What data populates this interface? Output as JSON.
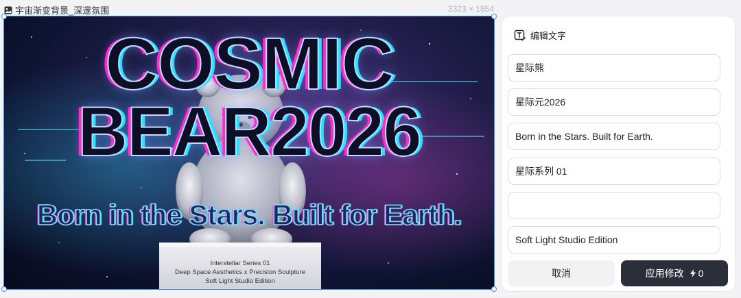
{
  "header": {
    "filename": "宇宙渐变背景_深邃氛围",
    "dimensions": "3323 × 1854"
  },
  "canvas": {
    "title_line1": "COSMIC",
    "title_line2": "BEAR2026",
    "tagline": "Born in the Stars. Built for Earth.",
    "pedestal_lines": [
      "Interstellar Series 01",
      "Deep Space Aesthetics x Precision Sculpture",
      "Soft Light Studio Edition"
    ]
  },
  "panel": {
    "title": "编辑文字",
    "fields": [
      "星际熊",
      "星际元2026",
      "Born in the Stars. Built for Earth.",
      "星际系列 01",
      "",
      "Soft Light Studio Edition"
    ],
    "cancel_label": "取消",
    "apply_label": "应用修改",
    "apply_cost": "0"
  },
  "icons": {
    "file": "image-icon",
    "edit": "text-edit-icon",
    "lightning": "lightning-icon"
  },
  "colors": {
    "accent": "#3c8bf5",
    "apply_bg": "#2b2f3a"
  }
}
